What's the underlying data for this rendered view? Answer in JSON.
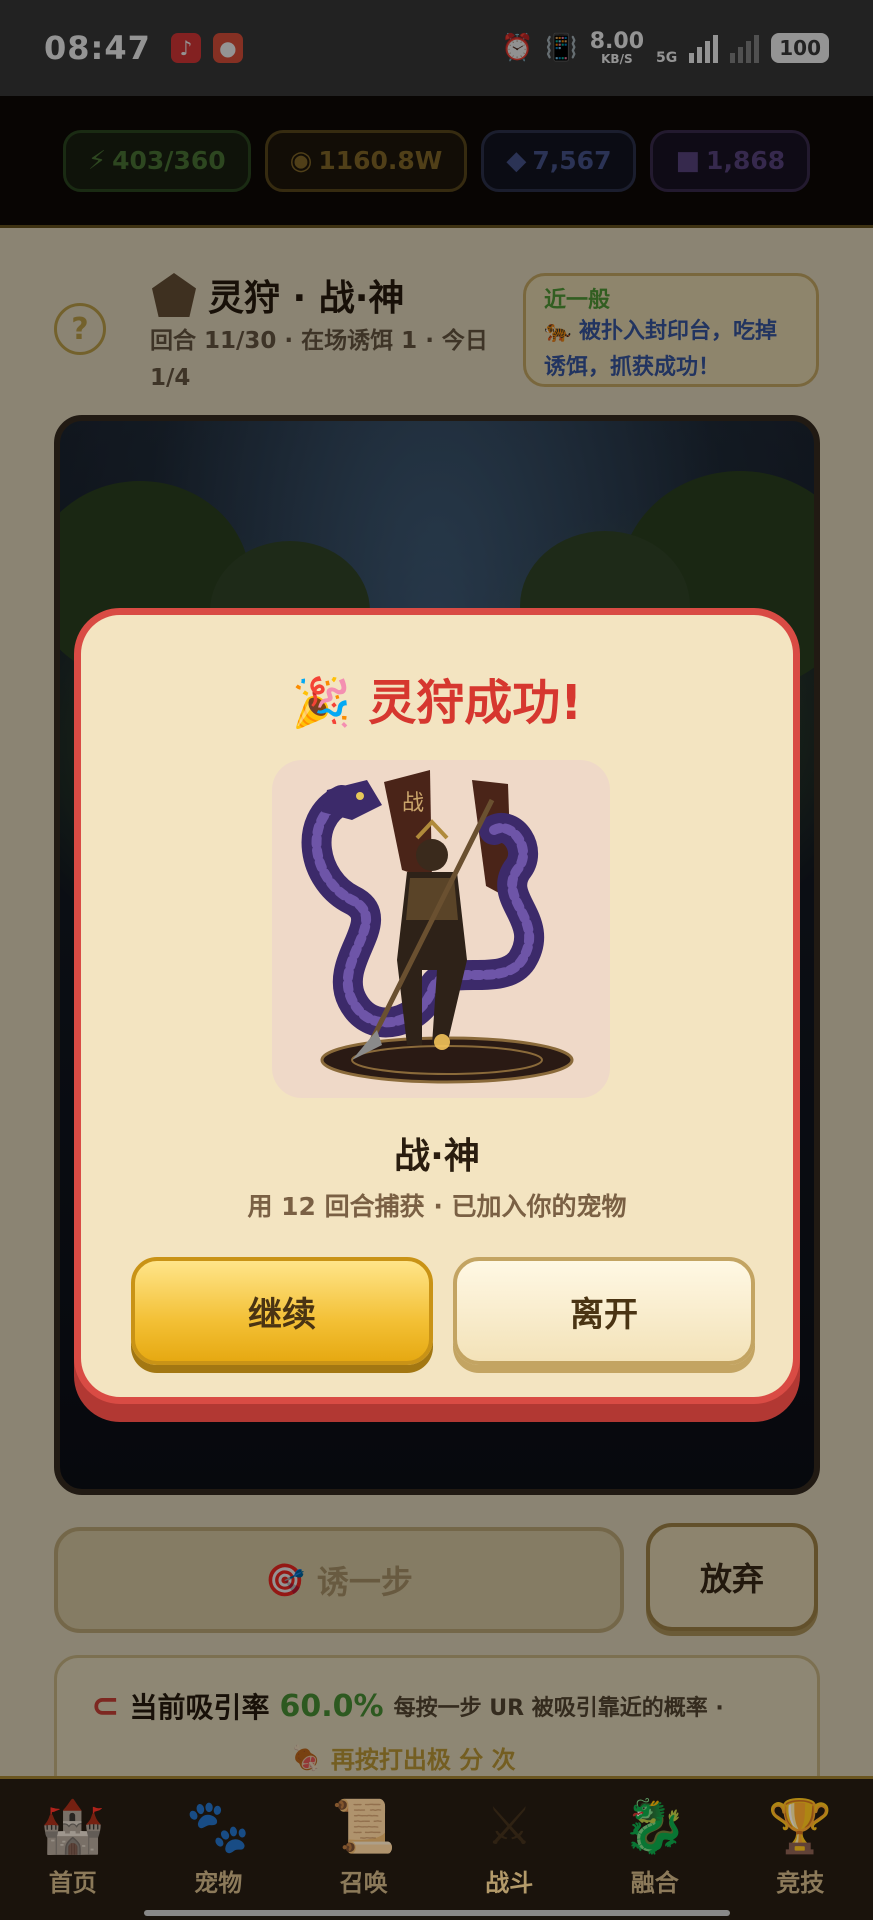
{
  "status_bar": {
    "time": "08:47",
    "speed_value": "8.00",
    "speed_unit": "KB/S",
    "network": "5G",
    "battery": "100"
  },
  "currency": {
    "energy": "403/360",
    "gold": "1160.8W",
    "gems": "7,567",
    "crystals": "1,868"
  },
  "hunt": {
    "help_label": "?",
    "title": "灵狩 · 战·神",
    "subtitle": "回合 11/30 · 在场诱饵 1 · 今日 1/4",
    "hint_title": "近一般",
    "hint_text": "🐅 被扑入封印台，吃掉诱饵，抓获成功！"
  },
  "controls": {
    "lure_label": "诱一步",
    "giveup_label": "放弃"
  },
  "attract": {
    "label": "当前吸引率",
    "rate": "60.0%",
    "desc": "每按一步 UR 被吸引靠近的概率 ·",
    "extra": "再按打出极 分 次"
  },
  "modal": {
    "title": "🎉 灵狩成功!",
    "name": "战·神",
    "desc": "用 12 回合捕获 · 已加入你的宠物",
    "continue_label": "继续",
    "leave_label": "离开",
    "portrait_banner": "战"
  },
  "nav": [
    {
      "label": "首页",
      "icon": "castle-icon"
    },
    {
      "label": "宠物",
      "icon": "paw-icon"
    },
    {
      "label": "召唤",
      "icon": "scroll-icon"
    },
    {
      "label": "战斗",
      "icon": "swords-icon"
    },
    {
      "label": "融合",
      "icon": "dragon-icon"
    },
    {
      "label": "竞技",
      "icon": "trophy-icon"
    }
  ]
}
